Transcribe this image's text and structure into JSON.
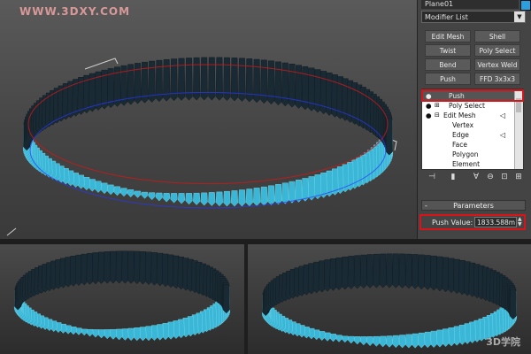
{
  "watermark": "WWW.3DXY.COM",
  "brand_mark": "3D学院",
  "panel": {
    "object_name": "Plane01",
    "modifier_list_label": "Modifier List",
    "buttons": [
      "Edit Mesh",
      "Shell",
      "Twist",
      "Poly Select",
      "Bend",
      "Vertex Weld",
      "Push",
      "FFD 3x3x3"
    ],
    "stack": [
      {
        "label": "Push",
        "selected": true
      },
      {
        "label": "Poly Select",
        "selected": false
      },
      {
        "label": "Edit Mesh",
        "selected": false
      },
      {
        "label": "Vertex",
        "selected": false
      },
      {
        "label": "Edge",
        "selected": false
      },
      {
        "label": "Face",
        "selected": false
      },
      {
        "label": "Polygon",
        "selected": false
      },
      {
        "label": "Element",
        "selected": false
      }
    ],
    "rollout_title": "Parameters",
    "push_value_label": "Push Value:",
    "push_value": "1833.588m"
  },
  "colors": {
    "band_cyan": "#3ab7d6",
    "band_dark": "#1a2a34",
    "edge_red": "#d01818",
    "edge_blue": "#2a38ff",
    "highlight_red": "#d8141a"
  },
  "icons": [
    "pin-icon",
    "eye-icon",
    "expand-icon",
    "edit-icon",
    "configure-icon",
    "lock-icon",
    "remove-icon",
    "triangle-icon"
  ]
}
